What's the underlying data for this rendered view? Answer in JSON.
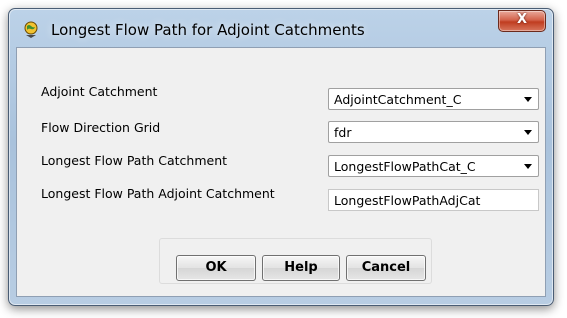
{
  "window": {
    "title": "Longest Flow Path for Adjoint Catchments",
    "close_glyph": "X"
  },
  "form": {
    "adjoint_catchment": {
      "label": "Adjoint Catchment",
      "value": "AdjointCatchment_C"
    },
    "flow_direction_grid": {
      "label": "Flow Direction Grid",
      "value": "fdr"
    },
    "longest_flow_path_catchment": {
      "label": "Longest Flow Path Catchment",
      "value": "LongestFlowPathCat_C"
    },
    "longest_flow_path_adjoint_catchment": {
      "label": "Longest Flow Path Adjoint Catchment",
      "value": "LongestFlowPathAdjCat"
    }
  },
  "buttons": {
    "ok": "OK",
    "help": "Help",
    "cancel": "Cancel"
  }
}
